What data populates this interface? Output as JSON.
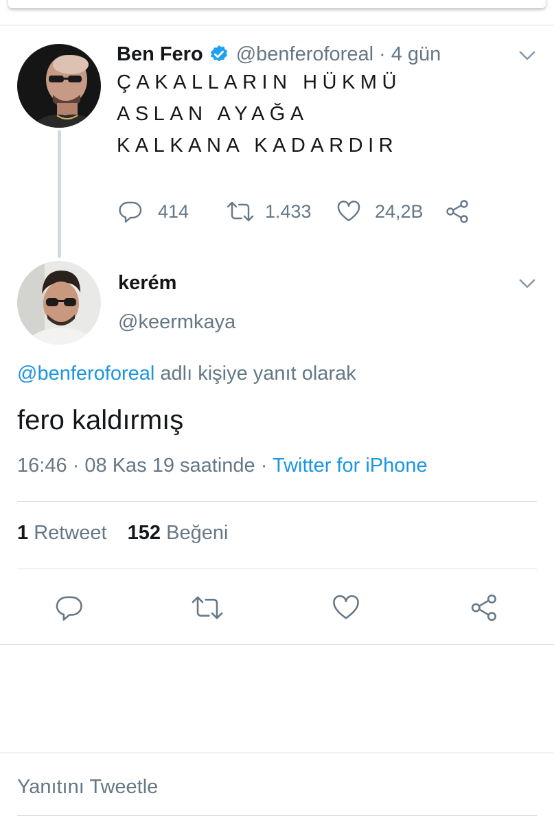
{
  "original_tweet": {
    "name": "Ben Fero",
    "handle": "@benferoforeal",
    "separator": "·",
    "time": "4 gün",
    "text_lines": [
      "ÇAKALLARIN HÜKMÜ",
      "ASLAN AYAĞA",
      "KALKANA KADARDIR"
    ],
    "replies": "414",
    "retweets": "1.433",
    "likes": "24,2B",
    "icons": [
      "reply-icon",
      "retweet-icon",
      "like-icon",
      "share-icon",
      "chevron-down-icon",
      "verified-badge-icon"
    ]
  },
  "reply_tweet": {
    "name": "kerém",
    "handle": "@keermkaya",
    "reply_to_mention": "@benferoforeal",
    "reply_to_text": "adlı kişiye yanıt olarak",
    "text": "fero kaldırmış",
    "time": "16:46",
    "separator": "·",
    "date": "08 Kas 19 saatinde",
    "separator2": "·",
    "source": "Twitter for iPhone",
    "retweet_count": "1",
    "retweet_label": "Retweet",
    "like_count": "152",
    "like_label": "Beğeni"
  },
  "reply_box": {
    "placeholder": "Yanıtını Tweetle"
  },
  "colors": {
    "link": "#1b95e0",
    "secondary": "#657786",
    "primary_text": "#14171a",
    "divider": "#d8dde2"
  }
}
